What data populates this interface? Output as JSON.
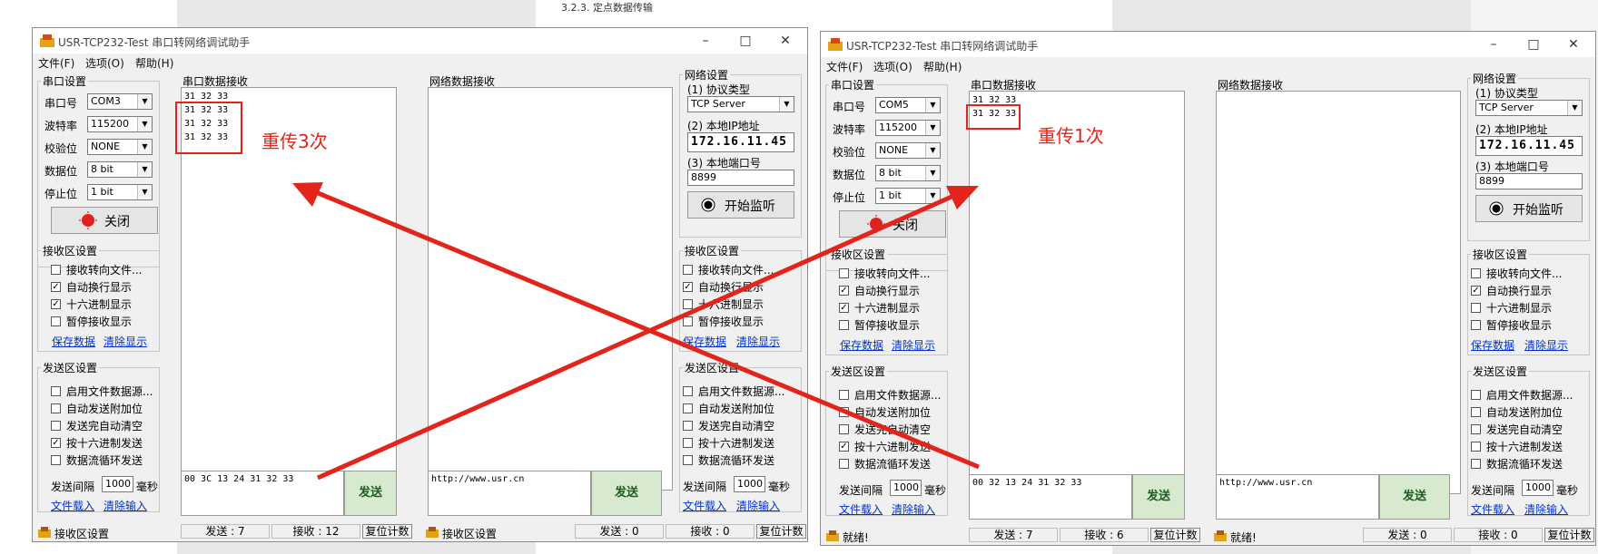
{
  "windows": [
    {
      "title": "USR-TCP232-Test 串口转网络调试助手",
      "menu": [
        "文件(F)",
        "选项(O)",
        "帮助(H)"
      ],
      "serial_settings": {
        "group_title": "串口设置",
        "port_label": "串口号",
        "port_value": "COM3",
        "baud_label": "波特率",
        "baud_value": "115200",
        "parity_label": "校验位",
        "parity_value": "NONE",
        "data_label": "数据位",
        "data_value": "8 bit",
        "stop_label": "停止位",
        "stop_value": "1 bit",
        "button_label": "关闭"
      },
      "recv_settings": {
        "group_title": "接收区设置",
        "options": [
          {
            "label": "接收转向文件...",
            "checked": false
          },
          {
            "label": "自动换行显示",
            "checked": true
          },
          {
            "label": "十六进制显示",
            "checked": true
          },
          {
            "label": "暂停接收显示",
            "checked": false
          }
        ],
        "save_link": "保存数据",
        "clear_link": "清除显示"
      },
      "send_settings": {
        "group_title": "发送区设置",
        "options": [
          {
            "label": "启用文件数据源...",
            "checked": false
          },
          {
            "label": "自动发送附加位",
            "checked": false
          },
          {
            "label": "发送完自动清空",
            "checked": false
          },
          {
            "label": "按十六进制发送",
            "checked": true
          },
          {
            "label": "数据流循环发送",
            "checked": false
          }
        ],
        "interval_label": "发送间隔",
        "interval_value": "1000",
        "interval_unit": "毫秒",
        "load_link": "文件载入",
        "clear_link": "清除输入"
      },
      "serial_recv": {
        "title": "串口数据接收",
        "lines": [
          "31 32 33",
          "31 32 33",
          "31 32 33",
          "31 32 33"
        ]
      },
      "net_recv": {
        "title": "网络数据接收",
        "lines": []
      },
      "serial_send_text": "00 3C 13 24 31 32 33",
      "net_send_text": "http://www.usr.cn",
      "send_button": "发送",
      "net_settings": {
        "group_title": "网络设置",
        "protocol_label": "(1) 协议类型",
        "protocol_value": "TCP Server",
        "ip_label": "(2) 本地IP地址",
        "ip_value": "172.16.11.45",
        "port_label": "(3) 本地端口号",
        "port_value": "8899",
        "listen_button": "开始监听"
      },
      "net_recv_settings": {
        "group_title": "接收区设置",
        "options": [
          {
            "label": "接收转向文件...",
            "checked": false
          },
          {
            "label": "自动换行显示",
            "checked": true
          },
          {
            "label": "十六进制显示",
            "checked": false
          },
          {
            "label": "暂停接收显示",
            "checked": false
          }
        ],
        "save_link": "保存数据",
        "clear_link": "清除显示"
      },
      "net_send_settings": {
        "group_title": "发送区设置",
        "options": [
          {
            "label": "启用文件数据源...",
            "checked": false
          },
          {
            "label": "自动发送附加位",
            "checked": false
          },
          {
            "label": "发送完自动清空",
            "checked": false
          },
          {
            "label": "按十六进制发送",
            "checked": false
          },
          {
            "label": "数据流循环发送",
            "checked": false
          }
        ],
        "interval_label": "发送间隔",
        "interval_value": "1000",
        "interval_unit": "毫秒",
        "load_link": "文件载入",
        "clear_link": "清除输入"
      },
      "status": {
        "left_text": "接收区设置",
        "serial_sent": "发送 : 7",
        "serial_recv": "接收 : 12",
        "serial_reset": "复位计数",
        "net_left_text": "接收区设置",
        "net_sent": "发送 : 0",
        "net_recv": "接收 : 0",
        "net_reset": "复位计数"
      }
    },
    {
      "title": "USR-TCP232-Test 串口转网络调试助手",
      "menu": [
        "文件(F)",
        "选项(O)",
        "帮助(H)"
      ],
      "serial_settings": {
        "group_title": "串口设置",
        "port_label": "串口号",
        "port_value": "COM5",
        "baud_label": "波特率",
        "baud_value": "115200",
        "parity_label": "校验位",
        "parity_value": "NONE",
        "data_label": "数据位",
        "data_value": "8 bit",
        "stop_label": "停止位",
        "stop_value": "1 bit",
        "button_label": "关闭"
      },
      "recv_settings": {
        "group_title": "接收区设置",
        "options": [
          {
            "label": "接收转向文件...",
            "checked": false
          },
          {
            "label": "自动换行显示",
            "checked": true
          },
          {
            "label": "十六进制显示",
            "checked": true
          },
          {
            "label": "暂停接收显示",
            "checked": false
          }
        ],
        "save_link": "保存数据",
        "clear_link": "清除显示"
      },
      "send_settings": {
        "group_title": "发送区设置",
        "options": [
          {
            "label": "启用文件数据源...",
            "checked": false
          },
          {
            "label": "自动发送附加位",
            "checked": false
          },
          {
            "label": "发送完自动清空",
            "checked": false
          },
          {
            "label": "按十六进制发送",
            "checked": true
          },
          {
            "label": "数据流循环发送",
            "checked": false
          }
        ],
        "interval_label": "发送间隔",
        "interval_value": "1000",
        "interval_unit": "毫秒",
        "load_link": "文件载入",
        "clear_link": "清除输入"
      },
      "serial_recv": {
        "title": "串口数据接收",
        "lines": [
          "31 32 33",
          "31 32 33"
        ]
      },
      "net_recv": {
        "title": "网络数据接收",
        "lines": []
      },
      "serial_send_text": "00 32 13 24 31 32 33",
      "net_send_text": "http://www.usr.cn",
      "send_button": "发送",
      "net_settings": {
        "group_title": "网络设置",
        "protocol_label": "(1) 协议类型",
        "protocol_value": "TCP Server",
        "ip_label": "(2) 本地IP地址",
        "ip_value": "172.16.11.45",
        "port_label": "(3) 本地端口号",
        "port_value": "8899",
        "listen_button": "开始监听"
      },
      "net_recv_settings": {
        "group_title": "接收区设置",
        "options": [
          {
            "label": "接收转向文件...",
            "checked": false
          },
          {
            "label": "自动换行显示",
            "checked": true
          },
          {
            "label": "十六进制显示",
            "checked": false
          },
          {
            "label": "暂停接收显示",
            "checked": false
          }
        ],
        "save_link": "保存数据",
        "clear_link": "清除显示"
      },
      "net_send_settings": {
        "group_title": "发送区设置",
        "options": [
          {
            "label": "启用文件数据源...",
            "checked": false
          },
          {
            "label": "自动发送附加位",
            "checked": false
          },
          {
            "label": "发送完自动清空",
            "checked": false
          },
          {
            "label": "按十六进制发送",
            "checked": false
          },
          {
            "label": "数据流循环发送",
            "checked": false
          }
        ],
        "interval_label": "发送间隔",
        "interval_value": "1000",
        "interval_unit": "毫秒",
        "load_link": "文件载入",
        "clear_link": "清除输入"
      },
      "status": {
        "left_text": "就绪!",
        "serial_sent": "发送 : 7",
        "serial_recv": "接收 : 6",
        "serial_reset": "复位计数",
        "net_left_text": "就绪!",
        "net_sent": "发送 : 0",
        "net_recv": "接收 : 0",
        "net_reset": "复位计数"
      }
    }
  ],
  "annotations": {
    "left": "重传3次",
    "right": "重传1次"
  },
  "background_doc": {
    "heading": "3.2.3. 定点数据传输"
  },
  "colors": {
    "annotation_red": "#e3241b",
    "window_bg": "#f0f0f0"
  }
}
